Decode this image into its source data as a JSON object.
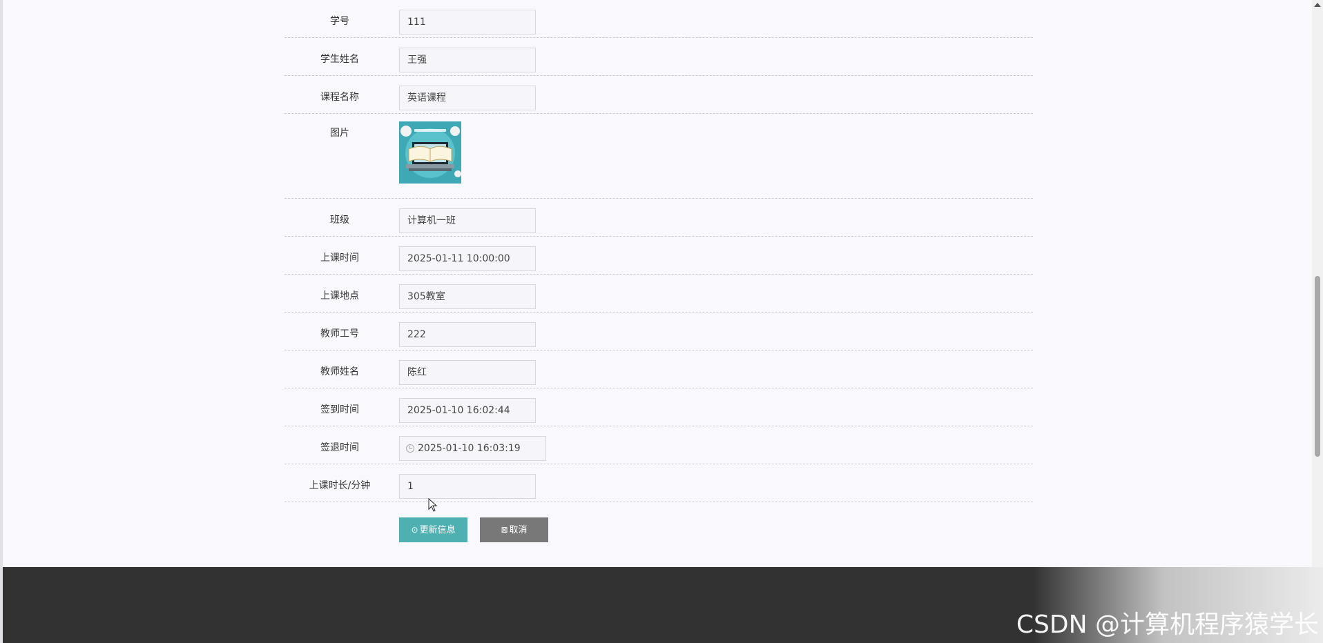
{
  "form": {
    "fields": [
      {
        "label": "学号",
        "value": "111"
      },
      {
        "label": "学生姓名",
        "value": "王强"
      },
      {
        "label": "课程名称",
        "value": "英语课程"
      },
      {
        "label": "图片",
        "value": ""
      },
      {
        "label": "班级",
        "value": "计算机一班"
      },
      {
        "label": "上课时间",
        "value": "2025-01-11 10:00:00"
      },
      {
        "label": "上课地点",
        "value": "305教室"
      },
      {
        "label": "教师工号",
        "value": "222"
      },
      {
        "label": "教师姓名",
        "value": "陈红"
      },
      {
        "label": "签到时间",
        "value": "2025-01-10 16:02:44"
      },
      {
        "label": "签退时间",
        "value": "2025-01-10 16:03:19"
      },
      {
        "label": "上课时长/分钟",
        "value": "1"
      }
    ]
  },
  "actions": {
    "update_label": "更新信息",
    "cancel_label": "取消"
  },
  "watermark": "CSDN @计算机程序猿学长",
  "colors": {
    "primary_button": "#4fb0b2",
    "cancel_button": "#787878",
    "footer": "#323232"
  }
}
